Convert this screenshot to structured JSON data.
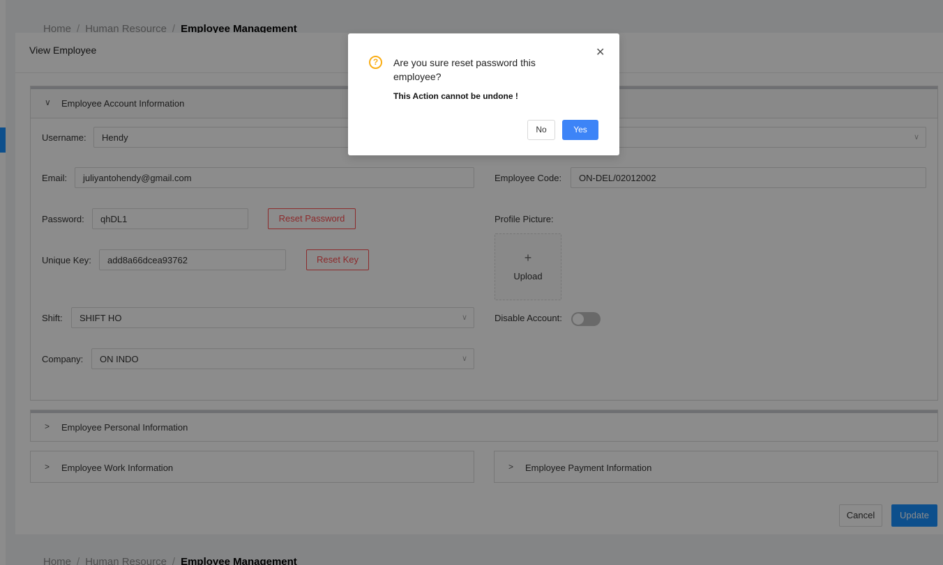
{
  "breadcrumb": {
    "items": [
      "Home",
      "Human Resource",
      "Employee Management"
    ]
  },
  "drawer": {
    "title": "View Employee",
    "account_panel": {
      "title": "Employee Account Information",
      "username_label": "Username:",
      "username_value": "Hendy",
      "email_label": "Email:",
      "email_value": "juliyantohendy@gmail.com",
      "employee_code_label": "Employee Code:",
      "employee_code_value": "ON-DEL/02012002",
      "password_label": "Password:",
      "password_value": "qhDL1",
      "reset_password_label": "Reset Password",
      "unique_key_label": "Unique Key:",
      "unique_key_value": "add8a66dcea93762",
      "reset_key_label": "Reset Key",
      "profile_picture_label": "Profile Picture:",
      "upload_plus": "+",
      "upload_label": "Upload",
      "shift_label": "Shift:",
      "shift_value": "SHIFT HO",
      "disable_account_label": "Disable Account:",
      "disable_account_on": false,
      "company_label": "Company:",
      "company_value": "ON INDO"
    },
    "personal_panel": {
      "title": "Employee Personal Information"
    },
    "work_panel": {
      "title": "Employee Work Information"
    },
    "payment_panel": {
      "title": "Employee Payment Information"
    },
    "footer": {
      "cancel_label": "Cancel",
      "update_label": "Update"
    }
  },
  "confirm": {
    "icon": "question-icon",
    "icon_glyph": "?",
    "title": "Are you sure reset password this employee?",
    "description": "This Action cannot be undone !",
    "close_glyph": "✕",
    "no_label": "No",
    "yes_label": "Yes"
  },
  "colors": {
    "primary": "#1890ff",
    "danger": "#ff4d4f",
    "warning": "#faad14",
    "confirm_yes": "#3d84f7"
  }
}
